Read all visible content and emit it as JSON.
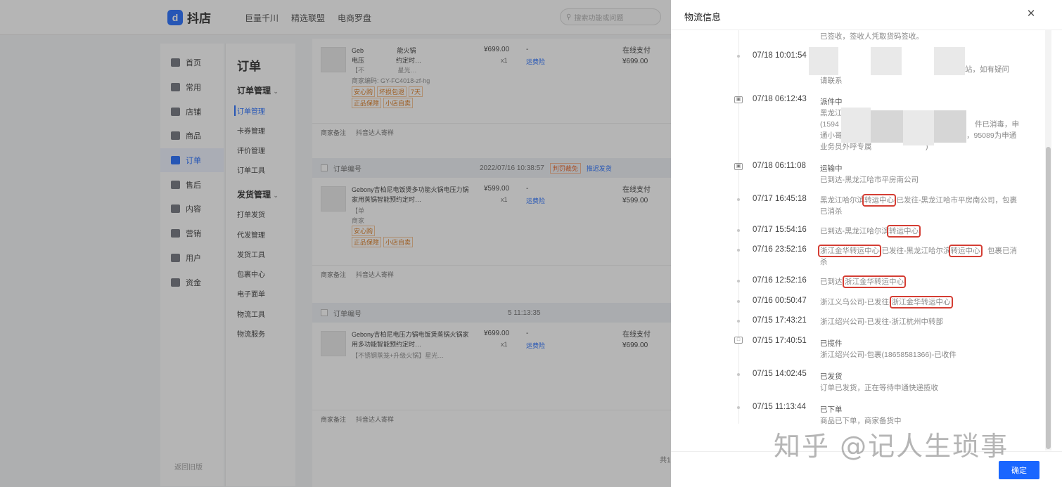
{
  "topbar": {
    "logo": "抖店",
    "nav": [
      "巨量千川",
      "精选联盟",
      "电商罗盘"
    ],
    "search_placeholder": "搜索功能或问题"
  },
  "sidebar": {
    "items": [
      {
        "label": "首页",
        "icon": "home-icon"
      },
      {
        "label": "常用",
        "icon": "grid-icon"
      },
      {
        "label": "店铺",
        "icon": "store-icon"
      },
      {
        "label": "商品",
        "icon": "goods-icon"
      },
      {
        "label": "订单",
        "icon": "order-icon",
        "active": true
      },
      {
        "label": "售后",
        "icon": "aftersale-icon"
      },
      {
        "label": "内容",
        "icon": "content-icon"
      },
      {
        "label": "营销",
        "icon": "marketing-icon"
      },
      {
        "label": "用户",
        "icon": "user-icon"
      },
      {
        "label": "资金",
        "icon": "wallet-icon"
      }
    ],
    "bottom_link": "返回旧版"
  },
  "subnav": {
    "title": "订单",
    "group1": "订单管理",
    "group1_items": [
      "订单管理",
      "卡券管理",
      "评价管理",
      "订单工具"
    ],
    "group2": "发货管理",
    "group2_items": [
      "打单发货",
      "代发管理",
      "发货工具",
      "包裹中心",
      "电子面单",
      "物流工具",
      "物流服务"
    ]
  },
  "orders": {
    "card1": {
      "title_a": "Geb",
      "title_b": "能火锅",
      "title_c": "电压",
      "title_d": "约定时…",
      "title_e": "【不",
      "title_f": "星光…",
      "code": "商家编码: GY-FC4018-zf-hg",
      "badges": [
        "安心购",
        "坏损包退",
        "7天",
        "正品保障",
        "小店自卖"
      ],
      "price": "¥699.00",
      "qty": "x1",
      "dash": "-",
      "insurance": "运费险",
      "pay_method": "在线支付",
      "pay_amount": "¥699.00",
      "foot": [
        "商家备注",
        "抖音达人寄样"
      ]
    },
    "card2": {
      "head_label": "订单编号",
      "head_time": "2022/07/16 10:38:57",
      "head_tag1": "判罚裁免",
      "head_tag2": "推迟发货",
      "title": "Gebony吉柏尼电饭煲多功能火锅电压力锅家用蒸锅智能预约定时…",
      "sub1": "【单",
      "sub2": "商家",
      "badges": [
        "安心购",
        "正品保障",
        "小店自卖"
      ],
      "price": "¥599.00",
      "qty": "x1",
      "dash": "-",
      "insurance": "运费险",
      "pay_method": "在线支付",
      "pay_amount": "¥599.00",
      "foot": [
        "商家备注",
        "抖音达人寄样"
      ]
    },
    "card3": {
      "head_label": "订单编号",
      "head_time": "5 11:13:35",
      "title": "Gebony吉柏尼电压力锅电饭煲蒸锅火锅家用多功能智能预约定时…",
      "sub1": "【不锈钢蒸笼+升级火锅】星光…",
      "price": "¥699.00",
      "qty": "x1",
      "dash": "-",
      "insurance": "运费险",
      "pay_method": "在线支付",
      "pay_amount": "¥699.00",
      "foot": [
        "商家备注",
        "抖音达人寄样"
      ]
    },
    "pager": "共1"
  },
  "drawer": {
    "title": "物流信息",
    "ok_label": "确定",
    "events": [
      {
        "time": "",
        "status": "",
        "desc": "已签收，签收人凭取货码签收。"
      },
      {
        "time": "07/18 10:01:54",
        "status": "",
        "desc_a": "站，如有疑问",
        "desc_b": "请联系"
      },
      {
        "time": "07/18 06:12:43",
        "status": "派件中",
        "desc_a": "黑龙江",
        "desc_b": "(1594",
        "desc_c": "件已消毒，申",
        "desc_d": "通小哥",
        "desc_e": "，95089为申通",
        "desc_f": "业务员外呼专属",
        "desc_g": ")"
      },
      {
        "time": "07/18 06:11:08",
        "status": "运输中",
        "desc": "已到达-黑龙江哈市平房南公司"
      },
      {
        "time": "07/17 16:45:18",
        "status": "",
        "desc_pre": "黑龙江哈尔滨",
        "desc_hl": "转运中心",
        "desc_post": "-已发往-黑龙江哈市平房南公司，包裹已消杀"
      },
      {
        "time": "07/17 15:54:16",
        "status": "",
        "desc_pre": "已到达-黑龙江哈尔滨",
        "desc_hl": "转运中心"
      },
      {
        "time": "07/16 23:52:16",
        "status": "",
        "desc_hl1": "浙江金华转运中心",
        "desc_mid": "-已发往-黑龙江哈尔滨",
        "desc_hl2": "转运中心",
        "desc_post": "，包裹已消杀"
      },
      {
        "time": "07/16 12:52:16",
        "status": "",
        "desc_pre": "已到达-",
        "desc_hl": "浙江金华转运中心"
      },
      {
        "time": "07/16 00:50:47",
        "status": "",
        "desc_pre": "浙江义乌公司-已发往-",
        "desc_hl": "浙江金华转运中心"
      },
      {
        "time": "07/15 17:43:21",
        "status": "",
        "desc": "浙江绍兴公司-已发往-浙江杭州中转部"
      },
      {
        "time": "07/15 17:40:51",
        "status": "已揽件",
        "desc": "浙江绍兴公司-包裹(18658581366)-已收件"
      },
      {
        "time": "07/15 14:02:45",
        "status": "已发货",
        "desc": "订单已发货，正在等待申通快递揽收"
      },
      {
        "time": "07/15 11:13:44",
        "status": "已下单",
        "desc": "商品已下单，商家备货中"
      }
    ]
  },
  "watermark": "知乎 @记人生琐事",
  "colors": {
    "accent": "#1966ff",
    "highlight": "#d43d33"
  }
}
